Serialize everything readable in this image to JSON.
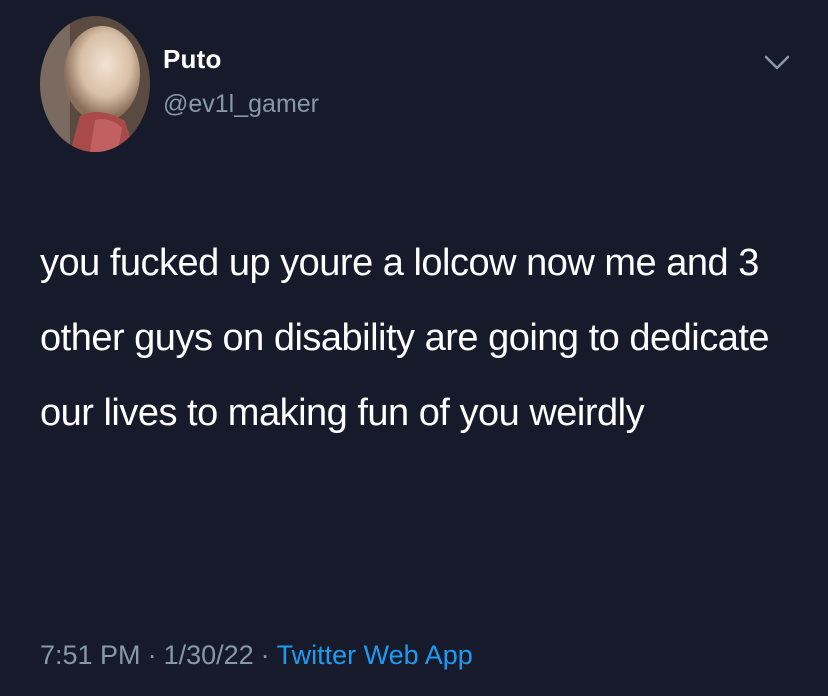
{
  "tweet": {
    "author": {
      "display_name": "Puto",
      "handle": "@ev1l_gamer",
      "avatar_icon": "profile-photo"
    },
    "menu_icon": "chevron-down-icon",
    "text": "you fucked up youre a lolcow now me and 3 other guys on disability are going to dedicate our lives to making fun of you weirdly",
    "time": "7:51 PM",
    "separator": "·",
    "date": "1/30/22",
    "source": "Twitter Web App"
  },
  "colors": {
    "background": "#161a2a",
    "text_primary": "#ffffff",
    "text_secondary": "#8899a6",
    "link": "#1d9bf0"
  }
}
